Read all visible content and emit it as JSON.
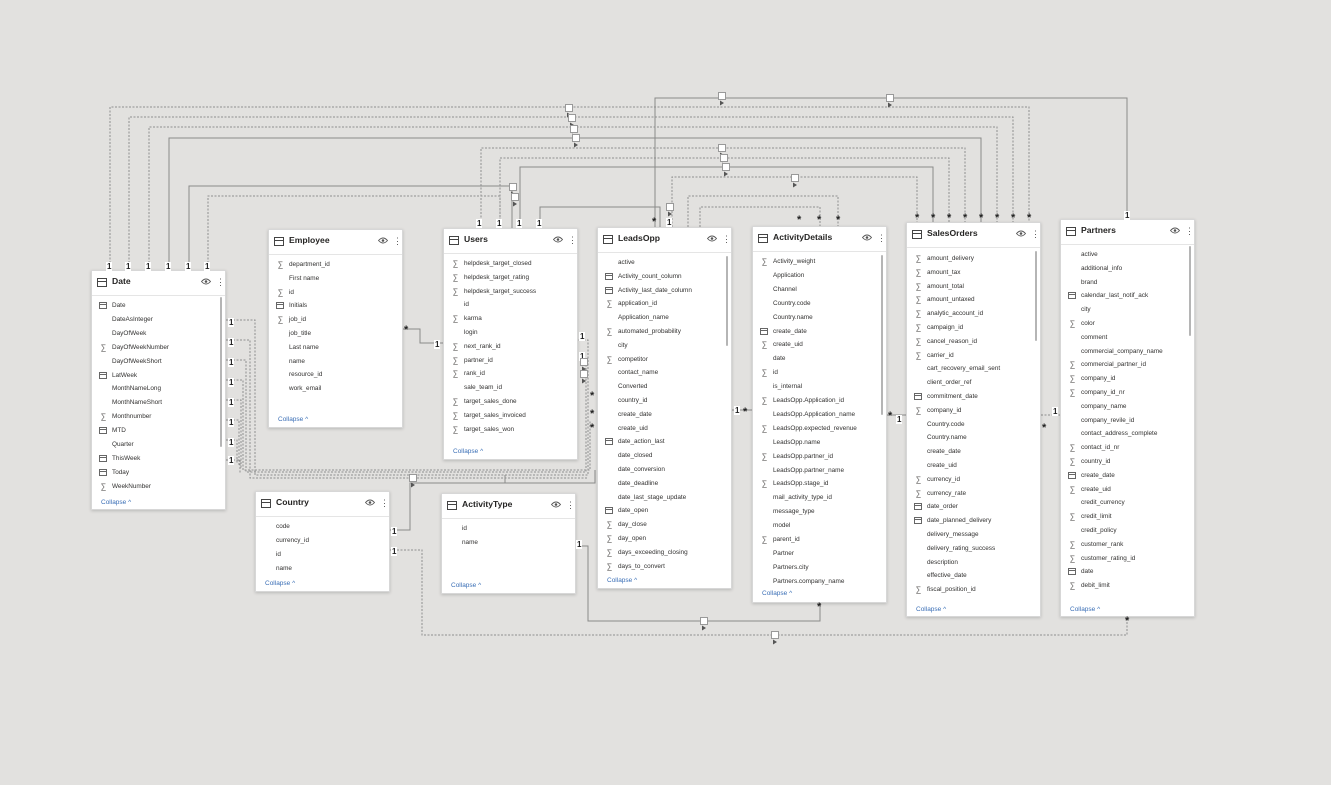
{
  "tables": [
    {
      "id": "date",
      "title": "Date",
      "collapse": "Collapse ^",
      "fields": [
        {
          "name": "Date",
          "icon": "calendar-icon"
        },
        {
          "name": "DateAsInteger",
          "icon": ""
        },
        {
          "name": "DayOfWeek",
          "icon": ""
        },
        {
          "name": "DayOfWeekNumber",
          "icon": "sigma-icon"
        },
        {
          "name": "DayOfWeekShort",
          "icon": ""
        },
        {
          "name": "LatWeek",
          "icon": "calculated-table-icon"
        },
        {
          "name": "MonthNameLong",
          "icon": ""
        },
        {
          "name": "MonthNameShort",
          "icon": ""
        },
        {
          "name": "Monthnumber",
          "icon": "sigma-icon"
        },
        {
          "name": "MTD",
          "icon": "calculated-table-icon"
        },
        {
          "name": "Quarter",
          "icon": ""
        },
        {
          "name": "ThisWeek",
          "icon": "calculated-table-icon"
        },
        {
          "name": "Today",
          "icon": "calculated-table-icon"
        },
        {
          "name": "WeekNumber",
          "icon": "sigma-icon"
        }
      ]
    },
    {
      "id": "employee",
      "title": "Employee",
      "collapse": "Collapse ^",
      "fields": [
        {
          "name": "department_id",
          "icon": "sigma-icon"
        },
        {
          "name": "First name",
          "icon": ""
        },
        {
          "name": "id",
          "icon": "sigma-icon"
        },
        {
          "name": "Initials",
          "icon": "calculated-table-icon"
        },
        {
          "name": "job_id",
          "icon": "sigma-icon"
        },
        {
          "name": "job_title",
          "icon": ""
        },
        {
          "name": "Last name",
          "icon": ""
        },
        {
          "name": "name",
          "icon": ""
        },
        {
          "name": "resource_id",
          "icon": ""
        },
        {
          "name": "work_email",
          "icon": ""
        }
      ]
    },
    {
      "id": "users",
      "title": "Users",
      "collapse": "Collapse ^",
      "fields": [
        {
          "name": "helpdesk_target_closed",
          "icon": "sigma-icon"
        },
        {
          "name": "helpdesk_target_rating",
          "icon": "sigma-icon"
        },
        {
          "name": "helpdesk_target_success",
          "icon": "sigma-icon"
        },
        {
          "name": "id",
          "icon": ""
        },
        {
          "name": "karma",
          "icon": "sigma-icon"
        },
        {
          "name": "login",
          "icon": ""
        },
        {
          "name": "next_rank_id",
          "icon": "sigma-icon"
        },
        {
          "name": "partner_id",
          "icon": "sigma-icon"
        },
        {
          "name": "rank_id",
          "icon": "sigma-icon"
        },
        {
          "name": "sale_team_id",
          "icon": ""
        },
        {
          "name": "target_sales_done",
          "icon": "sigma-icon"
        },
        {
          "name": "target_sales_invoiced",
          "icon": "sigma-icon"
        },
        {
          "name": "target_sales_won",
          "icon": "sigma-icon"
        }
      ]
    },
    {
      "id": "leadsopp",
      "title": "LeadsOpp",
      "collapse": "Collapse ^",
      "fields": [
        {
          "name": "active",
          "icon": ""
        },
        {
          "name": "Activity_count_column",
          "icon": "calculated-table-icon"
        },
        {
          "name": "Activity_last_date_column",
          "icon": "calculated-table-icon"
        },
        {
          "name": "application_id",
          "icon": "sigma-icon"
        },
        {
          "name": "Application_name",
          "icon": ""
        },
        {
          "name": "automated_probability",
          "icon": "sigma-icon"
        },
        {
          "name": "city",
          "icon": ""
        },
        {
          "name": "competitor",
          "icon": "sigma-icon"
        },
        {
          "name": "contact_name",
          "icon": ""
        },
        {
          "name": "Converted",
          "icon": ""
        },
        {
          "name": "country_id",
          "icon": ""
        },
        {
          "name": "create_date",
          "icon": ""
        },
        {
          "name": "create_uid",
          "icon": ""
        },
        {
          "name": "date_action_last",
          "icon": "calendar-icon"
        },
        {
          "name": "date_closed",
          "icon": ""
        },
        {
          "name": "date_conversion",
          "icon": ""
        },
        {
          "name": "date_deadline",
          "icon": ""
        },
        {
          "name": "date_last_stage_update",
          "icon": ""
        },
        {
          "name": "date_open",
          "icon": "calendar-icon"
        },
        {
          "name": "day_close",
          "icon": "sigma-icon"
        },
        {
          "name": "day_open",
          "icon": "sigma-icon"
        },
        {
          "name": "days_exceeding_closing",
          "icon": "sigma-icon"
        },
        {
          "name": "days_to_convert",
          "icon": "sigma-icon"
        }
      ]
    },
    {
      "id": "activitydetails",
      "title": "ActivityDetails",
      "collapse": "Collapse ^",
      "fields": [
        {
          "name": "Activity_weight",
          "icon": "sigma-icon"
        },
        {
          "name": "Application",
          "icon": ""
        },
        {
          "name": "Channel",
          "icon": ""
        },
        {
          "name": "Country.code",
          "icon": ""
        },
        {
          "name": "Country.name",
          "icon": ""
        },
        {
          "name": "create_date",
          "icon": "calendar-icon"
        },
        {
          "name": "create_uid",
          "icon": "sigma-icon"
        },
        {
          "name": "date",
          "icon": ""
        },
        {
          "name": "id",
          "icon": "sigma-icon"
        },
        {
          "name": "is_internal",
          "icon": ""
        },
        {
          "name": "LeadsOpp.Application_id",
          "icon": "sigma-icon"
        },
        {
          "name": "LeadsOpp.Application_name",
          "icon": ""
        },
        {
          "name": "LeadsOpp.expected_revenue",
          "icon": "sigma-icon"
        },
        {
          "name": "LeadsOpp.name",
          "icon": ""
        },
        {
          "name": "LeadsOpp.partner_id",
          "icon": "sigma-icon"
        },
        {
          "name": "LeadsOpp.partner_name",
          "icon": ""
        },
        {
          "name": "LeadsOpp.stage_id",
          "icon": "sigma-icon"
        },
        {
          "name": "mail_activity_type_id",
          "icon": ""
        },
        {
          "name": "message_type",
          "icon": ""
        },
        {
          "name": "model",
          "icon": ""
        },
        {
          "name": "parent_id",
          "icon": "sigma-icon"
        },
        {
          "name": "Partner",
          "icon": ""
        },
        {
          "name": "Partners.city",
          "icon": ""
        },
        {
          "name": "Partners.company_name",
          "icon": ""
        }
      ]
    },
    {
      "id": "salesorders",
      "title": "SalesOrders",
      "collapse": "Collapse ^",
      "fields": [
        {
          "name": "amount_delivery",
          "icon": "sigma-icon"
        },
        {
          "name": "amount_tax",
          "icon": "sigma-icon"
        },
        {
          "name": "amount_total",
          "icon": "sigma-icon"
        },
        {
          "name": "amount_untaxed",
          "icon": "sigma-icon"
        },
        {
          "name": "analytic_account_id",
          "icon": "sigma-icon"
        },
        {
          "name": "campaign_id",
          "icon": "sigma-icon"
        },
        {
          "name": "cancel_reason_id",
          "icon": "sigma-icon"
        },
        {
          "name": "carrier_id",
          "icon": "sigma-icon"
        },
        {
          "name": "cart_recovery_email_sent",
          "icon": ""
        },
        {
          "name": "client_order_ref",
          "icon": ""
        },
        {
          "name": "commitment_date",
          "icon": "calendar-icon"
        },
        {
          "name": "company_id",
          "icon": "sigma-icon"
        },
        {
          "name": "Country.code",
          "icon": ""
        },
        {
          "name": "Country.name",
          "icon": ""
        },
        {
          "name": "create_date",
          "icon": ""
        },
        {
          "name": "create_uid",
          "icon": ""
        },
        {
          "name": "currency_id",
          "icon": "sigma-icon"
        },
        {
          "name": "currency_rate",
          "icon": "sigma-icon"
        },
        {
          "name": "date_order",
          "icon": "calendar-icon"
        },
        {
          "name": "date_planned_delivery",
          "icon": "calendar-icon"
        },
        {
          "name": "delivery_message",
          "icon": ""
        },
        {
          "name": "delivery_rating_success",
          "icon": ""
        },
        {
          "name": "description",
          "icon": ""
        },
        {
          "name": "effective_date",
          "icon": ""
        },
        {
          "name": "fiscal_position_id",
          "icon": "sigma-icon"
        }
      ]
    },
    {
      "id": "partners",
      "title": "Partners",
      "collapse": "Collapse ^",
      "fields": [
        {
          "name": "active",
          "icon": ""
        },
        {
          "name": "additional_info",
          "icon": ""
        },
        {
          "name": "brand",
          "icon": ""
        },
        {
          "name": "calendar_last_notif_ack",
          "icon": "calendar-icon"
        },
        {
          "name": "city",
          "icon": ""
        },
        {
          "name": "color",
          "icon": "sigma-icon"
        },
        {
          "name": "comment",
          "icon": ""
        },
        {
          "name": "commercial_company_name",
          "icon": ""
        },
        {
          "name": "commercial_partner_id",
          "icon": "sigma-icon"
        },
        {
          "name": "company_id",
          "icon": "sigma-icon"
        },
        {
          "name": "company_id_nr",
          "icon": "sigma-icon"
        },
        {
          "name": "company_name",
          "icon": ""
        },
        {
          "name": "company_revile_id",
          "icon": ""
        },
        {
          "name": "contact_address_complete",
          "icon": ""
        },
        {
          "name": "contact_id_nr",
          "icon": "sigma-icon"
        },
        {
          "name": "country_id",
          "icon": "sigma-icon"
        },
        {
          "name": "create_date",
          "icon": "calendar-icon"
        },
        {
          "name": "create_uid",
          "icon": "sigma-icon"
        },
        {
          "name": "credit_currency",
          "icon": ""
        },
        {
          "name": "credit_limit",
          "icon": "sigma-icon"
        },
        {
          "name": "credit_policy",
          "icon": ""
        },
        {
          "name": "customer_rank",
          "icon": "sigma-icon"
        },
        {
          "name": "customer_rating_id",
          "icon": "sigma-icon"
        },
        {
          "name": "date",
          "icon": "calendar-icon"
        },
        {
          "name": "debit_limit",
          "icon": "sigma-icon"
        }
      ]
    },
    {
      "id": "country",
      "title": "Country",
      "collapse": "Collapse ^",
      "fields": [
        {
          "name": "code",
          "icon": ""
        },
        {
          "name": "currency_id",
          "icon": ""
        },
        {
          "name": "id",
          "icon": ""
        },
        {
          "name": "name",
          "icon": ""
        }
      ]
    },
    {
      "id": "activitytype",
      "title": "ActivityType",
      "collapse": "Collapse ^",
      "fields": [
        {
          "name": "id",
          "icon": ""
        },
        {
          "name": "name",
          "icon": ""
        }
      ]
    }
  ],
  "cardinality": {
    "one": "1",
    "many": "*"
  }
}
